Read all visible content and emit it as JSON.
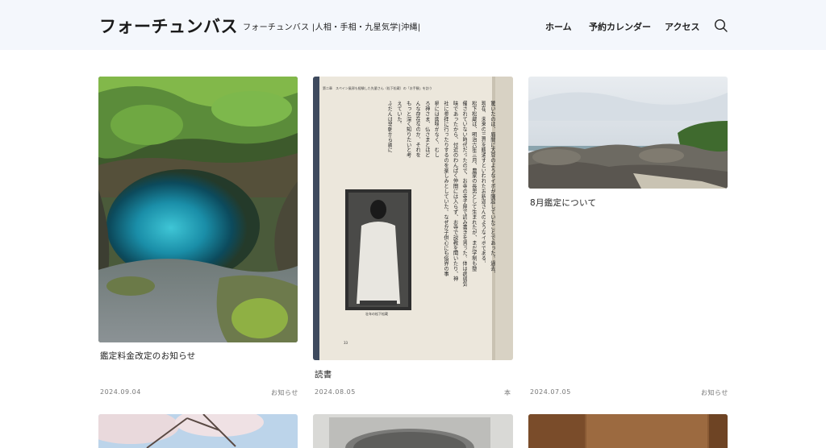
{
  "header": {
    "site_title": "フォーチュンバス",
    "tagline": "フォーチュンバス |人相・手相・九星気学|沖縄|",
    "nav": [
      {
        "label": "ホーム"
      },
      {
        "label": "予約カレンダー"
      },
      {
        "label": "アクセス"
      }
    ],
    "search_icon": "search-icon"
  },
  "posts": [
    {
      "title": "鑑定料金改定のお知らせ",
      "date": "2024.09.04",
      "category": "お知らせ",
      "image": "blue-spring-pool"
    },
    {
      "title": "読書",
      "date": "2024.08.05",
      "category": "本",
      "image": "open-book-page"
    },
    {
      "title": "8月鑑定について",
      "date": "2024.07.05",
      "category": "お知らせ",
      "image": "coastal-rocks"
    }
  ],
  "book_page": {
    "header": "第二章　スペイン風邪も経験した先輩さん（松下松蔵）の「お手観」を訪う",
    "caption": "壮年の松下松蔵",
    "page_number": "33",
    "columns": [
      "驚いたのは、眉間に大豆のようなイボが隆起していたことであった。過去、",
      "現在、未来の三界を観通すといわれたお釈迦さんのようなイボである。",
      "松下松蔵は、明治六年三月、農家の長男として生まれたが、まだ学制も整",
      "備されていない時代だったので、お寺の寺子屋で読み書きを習った。体は病弱気",
      "味であったから、付近のわんぱく仲間には入らず、お寺で説教を聞いたり、神",
      "社に参拝に行ったりするのを楽しみとしていた。なぜか子供心にも俗界の事",
      "柄には興味がなく、むし",
      "ろ神さま、仏さまとはど",
      "んな存在なのか、それを",
      "もっと深く知りたいと考",
      "えていた。",
      "ふだんは早朝から親に"
    ]
  }
}
